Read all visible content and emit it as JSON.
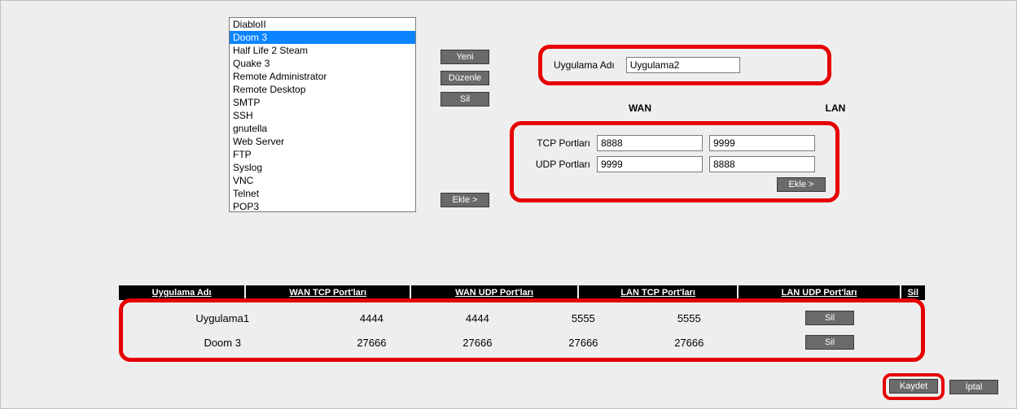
{
  "listbox": {
    "items": [
      "DiabloII",
      "Doom 3",
      "Half Life 2 Steam",
      "Quake 3",
      "Remote Administrator",
      "Remote Desktop",
      "SMTP",
      "SSH",
      "gnutella",
      "Web Server",
      "FTP",
      "Syslog",
      "VNC",
      "Telnet",
      "POP3"
    ],
    "selected_index": 1
  },
  "actions": {
    "new": "Yeni",
    "edit": "Düzenle",
    "delete": "Sil",
    "add": "Ekle >"
  },
  "form": {
    "app_label": "Uygulama Adı",
    "app_value": "Uygulama2",
    "wan_header": "WAN",
    "lan_header": "LAN",
    "tcp_label": "TCP Portları",
    "udp_label": "UDP Portları",
    "tcp_wan": "8888",
    "tcp_lan": "9999",
    "udp_wan": "9999",
    "udp_lan": "8888",
    "add_inner": "Ekle >"
  },
  "table": {
    "headers": {
      "app": "Uygulama Adı",
      "wan_tcp": "WAN TCP Port'ları",
      "wan_udp": "WAN UDP Port'ları",
      "lan_tcp": "LAN TCP Port'ları",
      "lan_udp": "LAN UDP Port'ları",
      "del": "Sil"
    },
    "rows": [
      {
        "app": "Uygulama1",
        "wan_tcp": "4444",
        "wan_udp": "4444",
        "lan_tcp": "5555",
        "lan_udp": "5555"
      },
      {
        "app": "Doom 3",
        "wan_tcp": "27666",
        "wan_udp": "27666",
        "lan_tcp": "27666",
        "lan_udp": "27666"
      }
    ],
    "del_btn": "Sil"
  },
  "footer": {
    "save": "Kaydet",
    "cancel": "İptal"
  }
}
